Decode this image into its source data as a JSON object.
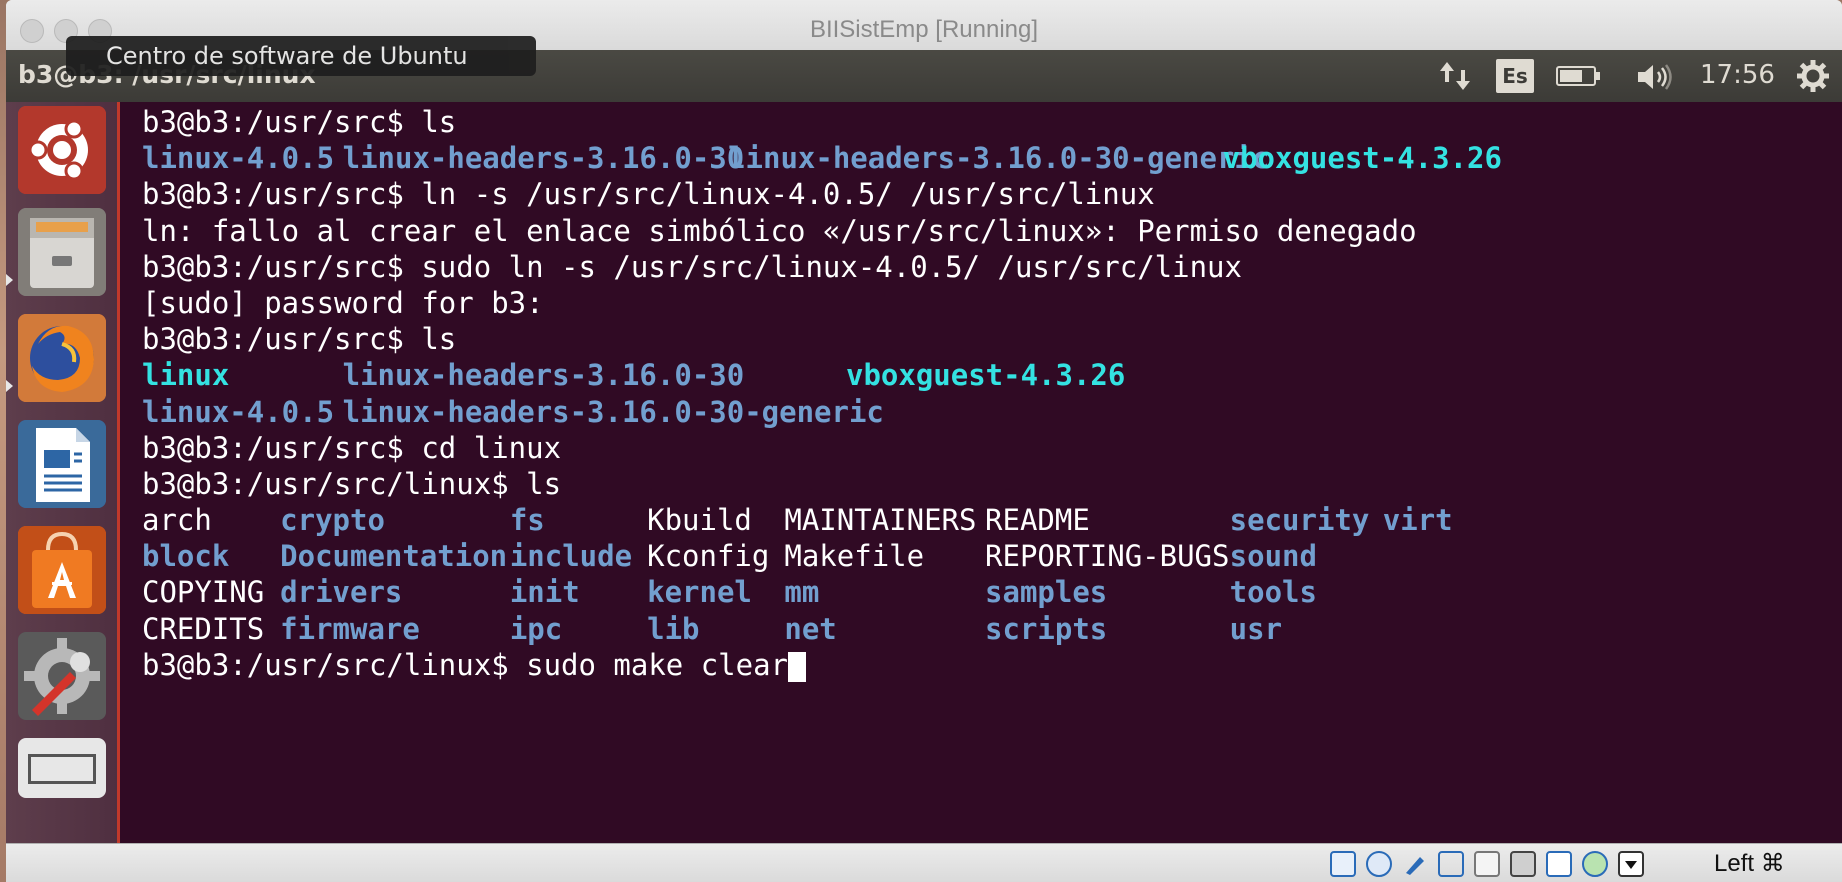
{
  "window": {
    "title": "BIISistEmp [Running]"
  },
  "ubuntu_panel": {
    "window_title": "b3@b3: /usr/src/linux",
    "tooltip": "Centro de software de Ubuntu",
    "lang": "Es",
    "clock": "17:56",
    "battery_level": 0.7
  },
  "launcher": {
    "items": [
      {
        "name": "Dash (Ubuntu)"
      },
      {
        "name": "Files"
      },
      {
        "name": "Firefox"
      },
      {
        "name": "LibreOffice Writer"
      },
      {
        "name": "Centro de software de Ubuntu"
      },
      {
        "name": "System Settings"
      },
      {
        "name": "Workspace"
      }
    ]
  },
  "terminal": {
    "lines": [
      {
        "kind": "plain",
        "text": "b3@b3:/usr/src$ ls"
      },
      {
        "kind": "ls1",
        "cols": [
          "linux-4.0.5",
          "linux-headers-3.16.0-30",
          "linux-headers-3.16.0-30-generic",
          "vboxguest-4.3.26"
        ]
      },
      {
        "kind": "plain",
        "text": "b3@b3:/usr/src$ ln -s /usr/src/linux-4.0.5/ /usr/src/linux"
      },
      {
        "kind": "plain",
        "text": "ln: fallo al crear el enlace simbólico «/usr/src/linux»: Permiso denegado"
      },
      {
        "kind": "plain",
        "text": "b3@b3:/usr/src$ sudo ln -s /usr/src/linux-4.0.5/ /usr/src/linux"
      },
      {
        "kind": "plain",
        "text": "[sudo] password for b3:"
      },
      {
        "kind": "plain",
        "text": "b3@b3:/usr/src$ ls"
      },
      {
        "kind": "ls2a",
        "cols": [
          "linux",
          "linux-headers-3.16.0-30",
          "vboxguest-4.3.26"
        ]
      },
      {
        "kind": "ls2b",
        "cols": [
          "linux-4.0.5",
          "linux-headers-3.16.0-30-generic"
        ]
      },
      {
        "kind": "plain",
        "text": "b3@b3:/usr/src$ cd linux"
      },
      {
        "kind": "plain",
        "text": "b3@b3:/usr/src/linux$ ls"
      }
    ],
    "kernel_listing": [
      [
        "arch",
        "crypto",
        "fs",
        "Kbuild",
        "MAINTAINERS",
        "README",
        "security",
        "virt"
      ],
      [
        "block",
        "Documentation",
        "include",
        "Kconfig",
        "Makefile",
        "REPORTING-BUGS",
        "sound",
        ""
      ],
      [
        "COPYING",
        "drivers",
        "init",
        "kernel",
        "mm",
        "samples",
        "tools",
        ""
      ],
      [
        "CREDITS",
        "firmware",
        "ipc",
        "lib",
        "net",
        "scripts",
        "usr",
        ""
      ]
    ],
    "kernel_listing_colors": [
      [
        "plain",
        "blue",
        "blue",
        "plain",
        "plain",
        "plain",
        "blue",
        "blue"
      ],
      [
        "blue",
        "blue",
        "blue",
        "plain",
        "plain",
        "plain",
        "blue",
        ""
      ],
      [
        "plain",
        "blue",
        "blue",
        "blue",
        "blue",
        "blue",
        "blue",
        ""
      ],
      [
        "plain",
        "blue",
        "blue",
        "blue",
        "blue",
        "blue",
        "blue",
        ""
      ]
    ],
    "prompt": "b3@b3:/usr/src/linux$ ",
    "current_input": "sudo make clear"
  },
  "vbox_status": {
    "host_key": "Left ⌘"
  },
  "colors": {
    "terminal_bg": "#300a24",
    "dir_blue": "#729fcf",
    "link_cyan": "#34e2e2",
    "panel_bg": "#3c3b37"
  }
}
